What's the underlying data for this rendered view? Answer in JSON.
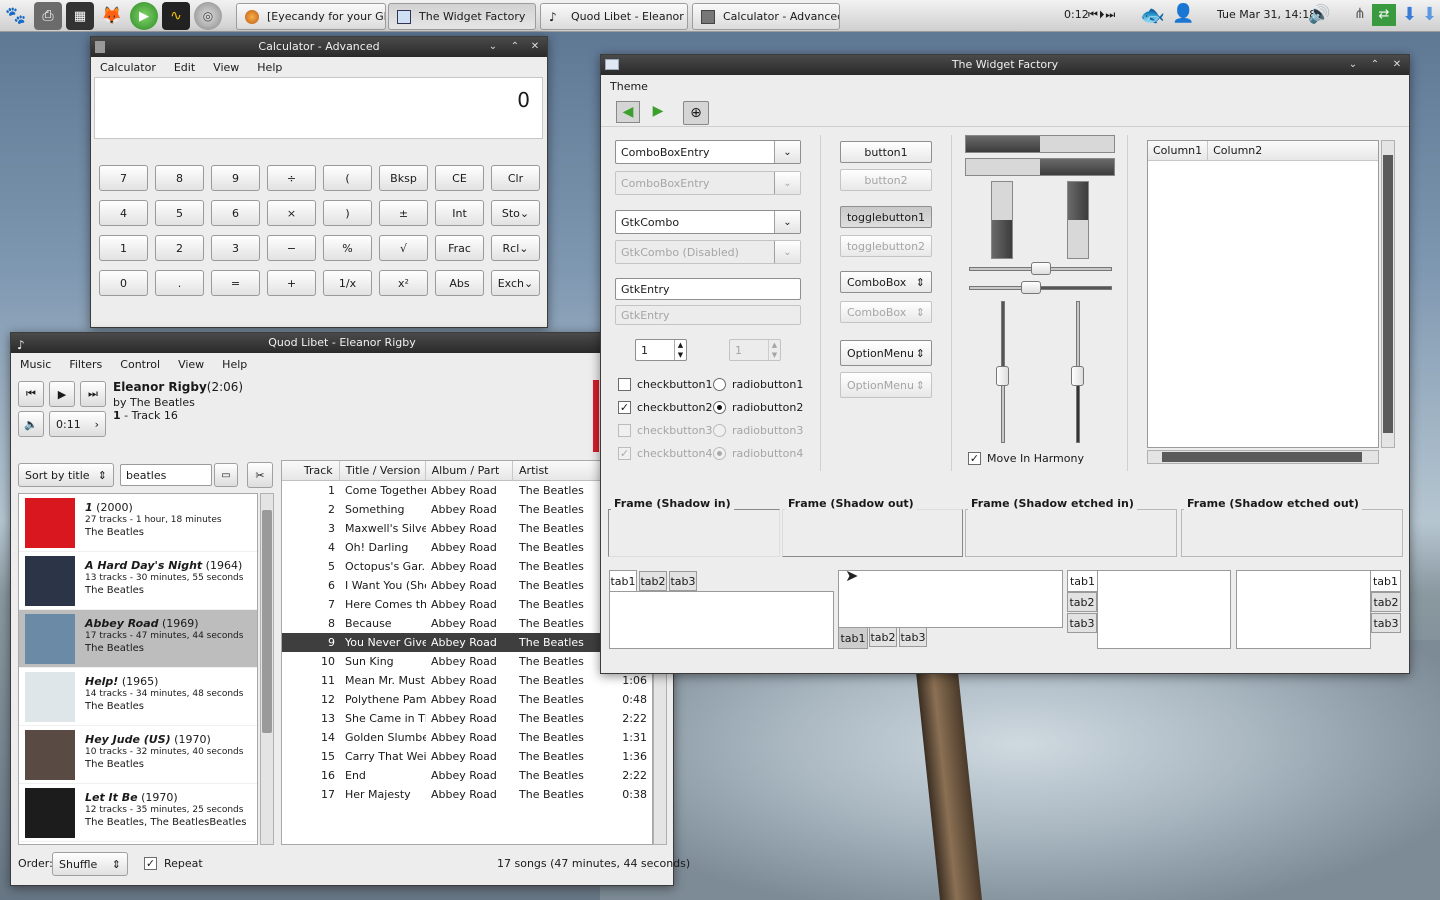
{
  "panel": {
    "tasks": [
      {
        "label": "[Eyecandy for your GN..."
      },
      {
        "label": "The Widget Factory"
      },
      {
        "label": "Quod Libet - Eleanor ..."
      },
      {
        "label": "Calculator - Advanced"
      }
    ],
    "player_time": "0:12",
    "clock": "Tue Mar 31, 14:18"
  },
  "calculator": {
    "title": "Calculator - Advanced",
    "menu": [
      "Calculator",
      "Edit",
      "View",
      "Help"
    ],
    "display": "0",
    "rows": [
      [
        "7",
        "8",
        "9",
        "÷",
        "(",
        "Bksp",
        "CE",
        "Clr"
      ],
      [
        "4",
        "5",
        "6",
        "×",
        ")",
        "±",
        "Int",
        "Sto"
      ],
      [
        "1",
        "2",
        "3",
        "−",
        "%",
        "√",
        "Frac",
        "Rcl"
      ],
      [
        "0",
        ".",
        "=",
        "+",
        "1/x",
        "x²",
        "Abs",
        "Exch"
      ]
    ]
  },
  "quodlibet": {
    "title": "Quod Libet - Eleanor Rigby",
    "menu": [
      "Music",
      "Filters",
      "Control",
      "View",
      "Help"
    ],
    "song": {
      "title": "Eleanor Rigby",
      "length": "(2:06)",
      "by": "by The Beatles",
      "track_num": "1",
      "track_label": " - Track 16"
    },
    "position": "0:11",
    "sort_label": "Sort by title",
    "search_value": "beatles",
    "albums": [
      {
        "title": "1",
        "year": " (2000)",
        "info": "27 tracks - 1 hour, 18 minutes",
        "artist": "The Beatles",
        "color": "#d8181e"
      },
      {
        "title": "A Hard Day's Night",
        "year": " (1964)",
        "info": "13 tracks - 30 minutes, 55 seconds",
        "artist": "The Beatles",
        "color": "#2c3448"
      },
      {
        "title": "Abbey Road",
        "year": " (1969)",
        "info": "17 tracks - 47 minutes, 44 seconds",
        "artist": "The Beatles",
        "color": "#6a8aa6"
      },
      {
        "title": "Help!",
        "year": " (1965)",
        "info": "14 tracks - 34 minutes, 48 seconds",
        "artist": "The Beatles",
        "color": "#dfe6ea"
      },
      {
        "title": "Hey Jude (US)",
        "year": " (1970)",
        "info": "10 tracks - 32 minutes, 40 seconds",
        "artist": "The Beatles",
        "color": "#5a4a44"
      },
      {
        "title": "Let It Be",
        "year": " (1970)",
        "info": "12 tracks - 35 minutes, 25 seconds",
        "artist": "The Beatles, The BeatlesBeatles",
        "color": "#1c1c1c"
      }
    ],
    "columns": [
      "Track",
      "Title / Version",
      "Album / Part",
      "Artist"
    ],
    "tracks": [
      {
        "n": "1",
        "title": "Come Together",
        "album": "Abbey Road",
        "artist": "The Beatles",
        "len": ""
      },
      {
        "n": "2",
        "title": "Something",
        "album": "Abbey Road",
        "artist": "The Beatles",
        "len": ""
      },
      {
        "n": "3",
        "title": "Maxwell's Silver...",
        "album": "Abbey Road",
        "artist": "The Beatles",
        "len": ""
      },
      {
        "n": "4",
        "title": "Oh! Darling",
        "album": "Abbey Road",
        "artist": "The Beatles",
        "len": ""
      },
      {
        "n": "5",
        "title": "Octopus's Gar...",
        "album": "Abbey Road",
        "artist": "The Beatles",
        "len": ""
      },
      {
        "n": "6",
        "title": "I Want You (She...",
        "album": "Abbey Road",
        "artist": "The Beatles",
        "len": ""
      },
      {
        "n": "7",
        "title": "Here Comes th...",
        "album": "Abbey Road",
        "artist": "The Beatles",
        "len": ""
      },
      {
        "n": "8",
        "title": "Because",
        "album": "Abbey Road",
        "artist": "The Beatles",
        "len": ""
      },
      {
        "n": "9",
        "title": "You Never Give...",
        "album": "Abbey Road",
        "artist": "The Beatles",
        "len": ""
      },
      {
        "n": "10",
        "title": "Sun King",
        "album": "Abbey Road",
        "artist": "The Beatles",
        "len": ""
      },
      {
        "n": "11",
        "title": "Mean Mr. Must...",
        "album": "Abbey Road",
        "artist": "The Beatles",
        "len": "1:06"
      },
      {
        "n": "12",
        "title": "Polythene Pam",
        "album": "Abbey Road",
        "artist": "The Beatles",
        "len": "0:48"
      },
      {
        "n": "13",
        "title": "She Came in Th...",
        "album": "Abbey Road",
        "artist": "The Beatles",
        "len": "2:22"
      },
      {
        "n": "14",
        "title": "Golden Slumbe...",
        "album": "Abbey Road",
        "artist": "The Beatles",
        "len": "1:31"
      },
      {
        "n": "15",
        "title": "Carry That Wei...",
        "album": "Abbey Road",
        "artist": "The Beatles",
        "len": "1:36"
      },
      {
        "n": "16",
        "title": "End",
        "album": "Abbey Road",
        "artist": "The Beatles",
        "len": "2:22"
      },
      {
        "n": "17",
        "title": "Her Majesty",
        "album": "Abbey Road",
        "artist": "The Beatles",
        "len": "0:38"
      }
    ],
    "selected_track_index": 8,
    "order_label": "Order:",
    "order_value": "Shuffle",
    "repeat_label": "Repeat",
    "status": "17 songs (47 minutes, 44 seconds)"
  },
  "widget_factory": {
    "title": "The Widget Factory",
    "menu": [
      "Theme"
    ],
    "combo_entry": "ComboBoxEntry",
    "combo_entry_dis": "ComboBoxEntry",
    "gtk_combo": "GtkCombo",
    "gtk_combo_dis": "GtkCombo (Disabled)",
    "entry": "GtkEntry",
    "entry_dis": "GtkEntry",
    "spin": "1",
    "spin_dis": "1",
    "checks": [
      "checkbutton1",
      "checkbutton2",
      "checkbutton3",
      "checkbutton4"
    ],
    "radios": [
      "radiobutton1",
      "radiobutton2",
      "radiobutton3",
      "radiobutton4"
    ],
    "button1": "button1",
    "button2": "button2",
    "toggle1": "togglebutton1",
    "toggle2": "togglebutton2",
    "combobox": "ComboBox",
    "combobox_dis": "ComboBox",
    "optionmenu": "OptionMenu",
    "optionmenu_dis": "OptionMenu",
    "harmony": "Move In Harmony",
    "tree_columns": [
      "Column1",
      "Column2"
    ],
    "frames": [
      "Frame (Shadow in)",
      "Frame (Shadow out)",
      "Frame (Shadow etched in)",
      "Frame (Shadow etched out)"
    ],
    "tabs": [
      "tab1",
      "tab2",
      "tab3"
    ],
    "progress_h": 0.5,
    "progress_v": 0.5,
    "hscale_1": 0.5,
    "hscale_2": 0.5
  }
}
